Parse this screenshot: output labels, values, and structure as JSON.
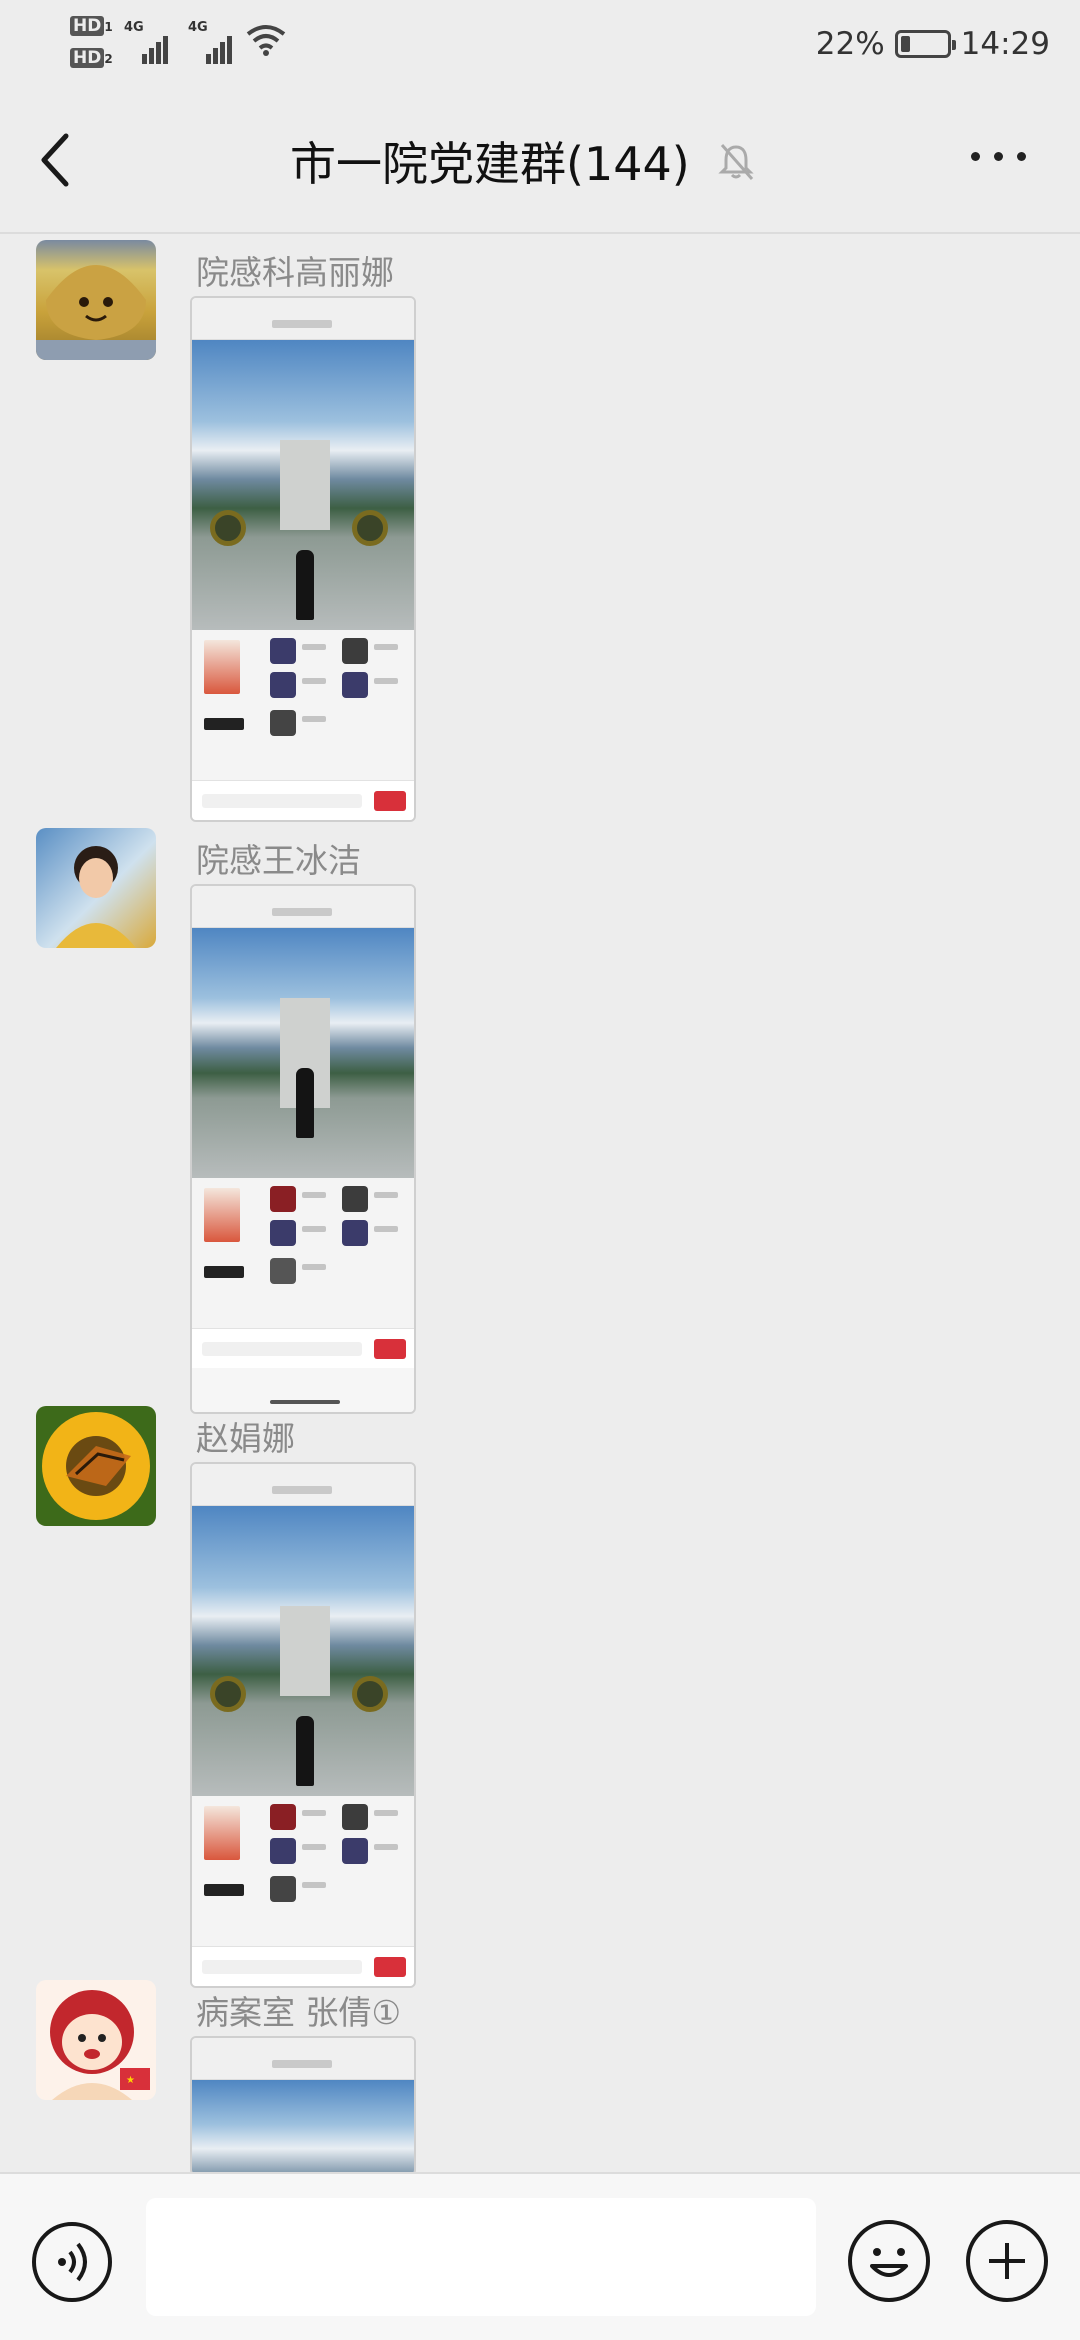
{
  "status_bar": {
    "hd1": "HD",
    "hd1_sub": "1",
    "hd2": "HD",
    "hd2_sub": "2",
    "net1": "4G",
    "net2": "4G",
    "battery_percent": "22%",
    "battery_level": 0.22,
    "time": "14:29",
    "icons": [
      "signal-icon",
      "wifi-icon",
      "battery-icon"
    ]
  },
  "header": {
    "title": "市一院党建群(144)",
    "icons": [
      "back-arrow-icon",
      "mute-bell-icon",
      "more-dots-icon"
    ]
  },
  "messages": [
    {
      "sender": "院感科高丽娜",
      "avatar": "avatar-yellow-hat",
      "type": "image"
    },
    {
      "sender": "院感王冰洁",
      "avatar": "avatar-girl-photo",
      "type": "image"
    },
    {
      "sender": "赵娟娜",
      "avatar": "avatar-sunflower-butterfly",
      "type": "image"
    },
    {
      "sender": "病案室 张倩①",
      "avatar": "avatar-cartoon-girl",
      "type": "image"
    }
  ],
  "input_bar": {
    "icons": [
      "voice-icon",
      "emoji-icon",
      "plus-icon"
    ],
    "text_value": ""
  },
  "colors": {
    "background": "#ededed",
    "sender_name": "#8a8a8a",
    "input_bar": "#f7f7f7"
  }
}
